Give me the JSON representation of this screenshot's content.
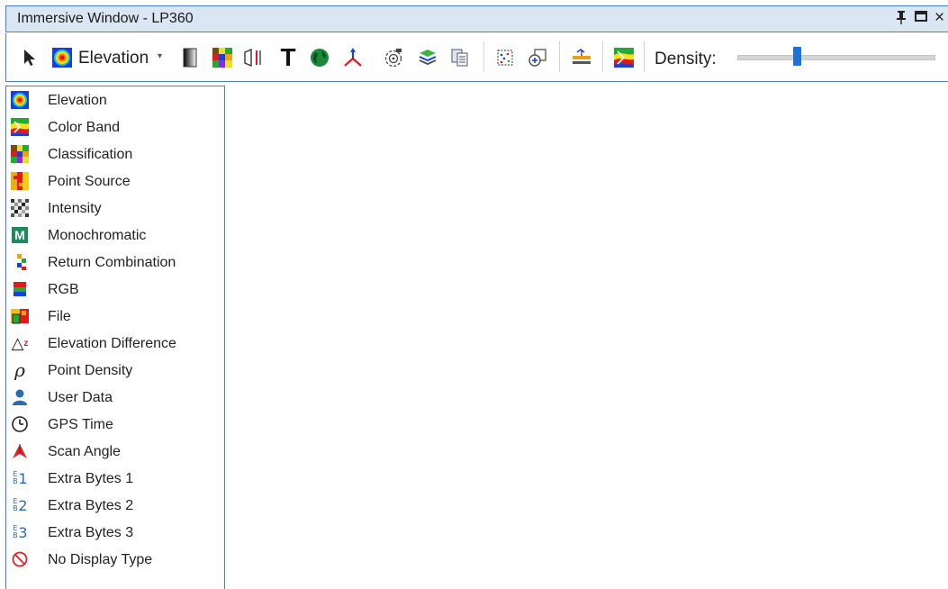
{
  "window": {
    "title": "Immersive Window - LP360",
    "pin_glyph": "1",
    "restore_glyph": "□",
    "close_glyph": "×"
  },
  "toolbar": {
    "display_type_label": "Elevation",
    "dropdown_glyph": "▾",
    "density_label": "Density:",
    "density_value": 0.3,
    "tools": [
      {
        "name": "select-arrow-icon"
      },
      {
        "name": "elevation-display-icon"
      },
      {
        "name": "grayscale-gradient-icon"
      },
      {
        "name": "classification-grid-icon"
      },
      {
        "name": "profile-view-icon"
      },
      {
        "name": "text-tool-icon",
        "glyph": "T"
      },
      {
        "name": "globe-icon"
      },
      {
        "name": "axis-orientation-icon"
      },
      {
        "name": "target-camera-icon"
      },
      {
        "name": "layers-icon"
      },
      {
        "name": "copy-pages-icon"
      },
      {
        "name": "point-grid-icon"
      },
      {
        "name": "zoom-window-icon"
      },
      {
        "name": "measure-height-icon"
      },
      {
        "name": "color-band-icon"
      }
    ]
  },
  "menu": {
    "items": [
      {
        "label": "Elevation",
        "icon": "elevation-icon"
      },
      {
        "label": "Color Band",
        "icon": "color-band-icon"
      },
      {
        "label": "Classification",
        "icon": "classification-icon"
      },
      {
        "label": "Point Source",
        "icon": "point-source-icon"
      },
      {
        "label": "Intensity",
        "icon": "intensity-icon"
      },
      {
        "label": "Monochromatic",
        "icon": "monochromatic-icon",
        "glyph": "M"
      },
      {
        "label": "Return Combination",
        "icon": "return-combination-icon"
      },
      {
        "label": "RGB",
        "icon": "rgb-icon"
      },
      {
        "label": "File",
        "icon": "file-icon"
      },
      {
        "label": "Elevation Difference",
        "icon": "elevation-difference-icon",
        "glyph": "△",
        "sup": "z"
      },
      {
        "label": "Point Density",
        "icon": "point-density-icon",
        "glyph": "ρ"
      },
      {
        "label": "User Data",
        "icon": "user-data-icon"
      },
      {
        "label": "GPS Time",
        "icon": "gps-time-icon"
      },
      {
        "label": "Scan Angle",
        "icon": "scan-angle-icon"
      },
      {
        "label": "Extra Bytes 1",
        "icon": "extra-bytes-1-icon",
        "glyph": "1"
      },
      {
        "label": "Extra Bytes 2",
        "icon": "extra-bytes-2-icon",
        "glyph": "2"
      },
      {
        "label": "Extra Bytes 3",
        "icon": "extra-bytes-3-icon",
        "glyph": "3"
      },
      {
        "label": "No Display Type",
        "icon": "no-display-type-icon"
      }
    ]
  },
  "colors": {
    "accent_border": "#4b7fc8",
    "title_bg": "#dbe6f4",
    "slider_thumb": "#1e72d6",
    "no_display_red": "#d9262a",
    "user_blue": "#2b6cb0"
  }
}
